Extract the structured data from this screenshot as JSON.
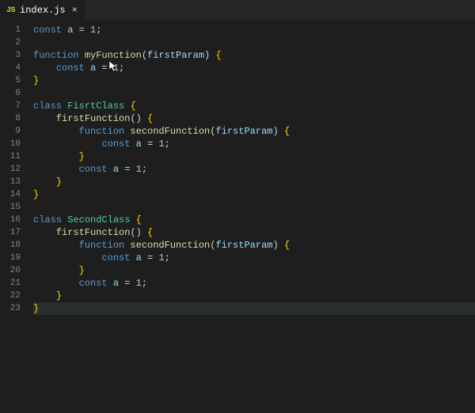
{
  "tab": {
    "icon_label": "JS",
    "title": "index.js",
    "close_glyph": "×"
  },
  "line_numbers": [
    "1",
    "2",
    "3",
    "4",
    "5",
    "6",
    "7",
    "8",
    "9",
    "10",
    "11",
    "12",
    "13",
    "14",
    "15",
    "16",
    "17",
    "18",
    "19",
    "20",
    "21",
    "22",
    "23"
  ],
  "highlighted_line": 23,
  "code": [
    [
      [
        "kw",
        "const"
      ],
      [
        "pn",
        " "
      ],
      [
        "name",
        "a"
      ],
      [
        "pn",
        " = "
      ],
      [
        "num",
        "1"
      ],
      [
        "pn",
        ";"
      ]
    ],
    [],
    [
      [
        "kw",
        "function"
      ],
      [
        "pn",
        " "
      ],
      [
        "fn",
        "myFunction"
      ],
      [
        "pn",
        "("
      ],
      [
        "name",
        "firstParam"
      ],
      [
        "pn",
        ") "
      ],
      [
        "brc",
        "{"
      ]
    ],
    [
      [
        "pn",
        "    "
      ],
      [
        "kw",
        "const"
      ],
      [
        "pn",
        " "
      ],
      [
        "name",
        "a"
      ],
      [
        "pn",
        " = "
      ],
      [
        "num",
        "1"
      ],
      [
        "pn",
        ";"
      ]
    ],
    [
      [
        "brc",
        "}"
      ]
    ],
    [],
    [
      [
        "kw",
        "class"
      ],
      [
        "pn",
        " "
      ],
      [
        "cls",
        "FisrtClass"
      ],
      [
        "pn",
        " "
      ],
      [
        "brc",
        "{"
      ]
    ],
    [
      [
        "pn",
        "    "
      ],
      [
        "fn",
        "firstFunction"
      ],
      [
        "pn",
        "() "
      ],
      [
        "brc",
        "{"
      ]
    ],
    [
      [
        "pn",
        "        "
      ],
      [
        "kw",
        "function"
      ],
      [
        "pn",
        " "
      ],
      [
        "fn",
        "secondFunction"
      ],
      [
        "pn",
        "("
      ],
      [
        "name",
        "firstParam"
      ],
      [
        "pn",
        ") "
      ],
      [
        "brc",
        "{"
      ]
    ],
    [
      [
        "pn",
        "            "
      ],
      [
        "kw",
        "const"
      ],
      [
        "pn",
        " "
      ],
      [
        "name",
        "a"
      ],
      [
        "pn",
        " = "
      ],
      [
        "num",
        "1"
      ],
      [
        "pn",
        ";"
      ]
    ],
    [
      [
        "pn",
        "        "
      ],
      [
        "brc",
        "}"
      ]
    ],
    [
      [
        "pn",
        "        "
      ],
      [
        "kw",
        "const"
      ],
      [
        "pn",
        " "
      ],
      [
        "name",
        "a"
      ],
      [
        "pn",
        " = "
      ],
      [
        "num",
        "1"
      ],
      [
        "pn",
        ";"
      ]
    ],
    [
      [
        "pn",
        "    "
      ],
      [
        "brc",
        "}"
      ]
    ],
    [
      [
        "brc",
        "}"
      ]
    ],
    [],
    [
      [
        "kw",
        "class"
      ],
      [
        "pn",
        " "
      ],
      [
        "cls",
        "SecondClass"
      ],
      [
        "pn",
        " "
      ],
      [
        "brc",
        "{"
      ]
    ],
    [
      [
        "pn",
        "    "
      ],
      [
        "fn",
        "firstFunction"
      ],
      [
        "pn",
        "() "
      ],
      [
        "brc",
        "{"
      ]
    ],
    [
      [
        "pn",
        "        "
      ],
      [
        "kw",
        "function"
      ],
      [
        "pn",
        " "
      ],
      [
        "fn",
        "secondFunction"
      ],
      [
        "pn",
        "("
      ],
      [
        "name",
        "firstParam"
      ],
      [
        "pn",
        ") "
      ],
      [
        "brc",
        "{"
      ]
    ],
    [
      [
        "pn",
        "            "
      ],
      [
        "kw",
        "const"
      ],
      [
        "pn",
        " "
      ],
      [
        "name",
        "a"
      ],
      [
        "pn",
        " = "
      ],
      [
        "num",
        "1"
      ],
      [
        "pn",
        ";"
      ]
    ],
    [
      [
        "pn",
        "        "
      ],
      [
        "brc",
        "}"
      ]
    ],
    [
      [
        "pn",
        "        "
      ],
      [
        "kw",
        "const"
      ],
      [
        "pn",
        " "
      ],
      [
        "name",
        "a"
      ],
      [
        "pn",
        " = "
      ],
      [
        "num",
        "1"
      ],
      [
        "pn",
        ";"
      ]
    ],
    [
      [
        "pn",
        "    "
      ],
      [
        "brc",
        "}"
      ]
    ],
    [
      [
        "brc",
        "}"
      ]
    ]
  ]
}
